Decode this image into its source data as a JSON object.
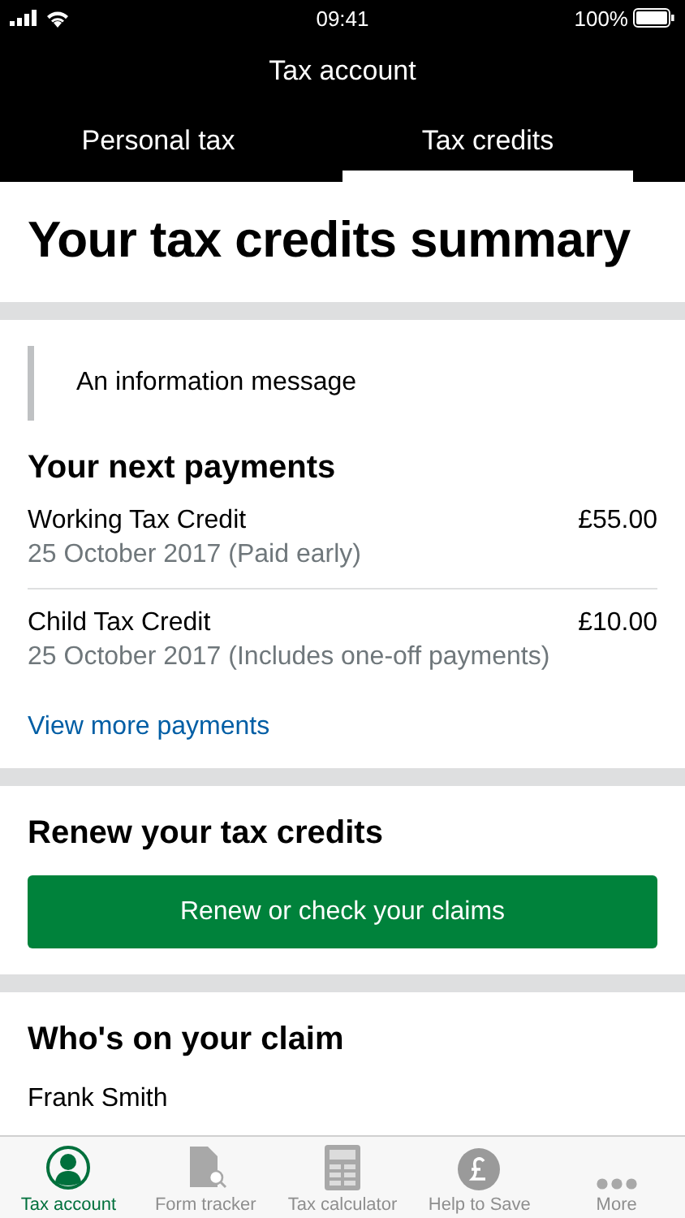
{
  "status_bar": {
    "time": "09:41",
    "battery": "100%"
  },
  "header": {
    "title": "Tax account"
  },
  "tabs": [
    {
      "label": "Personal tax",
      "selected": false
    },
    {
      "label": "Tax credits",
      "selected": true
    }
  ],
  "page_title": "Your tax credits summary",
  "info_message": "An information message",
  "payments": {
    "heading": "Your next payments",
    "items": [
      {
        "name": "Working Tax Credit",
        "amount": "£55.00",
        "detail": "25 October 2017 (Paid early)"
      },
      {
        "name": "Child Tax Credit",
        "amount": "£10.00",
        "detail": "25 October 2017 (Includes one-off payments)"
      }
    ],
    "link": "View more payments"
  },
  "renew": {
    "heading": "Renew your tax credits",
    "button": "Renew or check your claims"
  },
  "claim": {
    "heading": "Who's on your claim",
    "people": [
      "Frank Smith"
    ]
  },
  "tab_bar": [
    {
      "kind": "person",
      "label": "Tax account",
      "selected": true
    },
    {
      "kind": "form",
      "label": "Form tracker",
      "selected": false
    },
    {
      "kind": "calculator",
      "label": "Tax calculator",
      "selected": false
    },
    {
      "kind": "pound",
      "label": "Help to Save",
      "selected": false
    },
    {
      "kind": "more",
      "label": "More",
      "selected": false
    }
  ]
}
